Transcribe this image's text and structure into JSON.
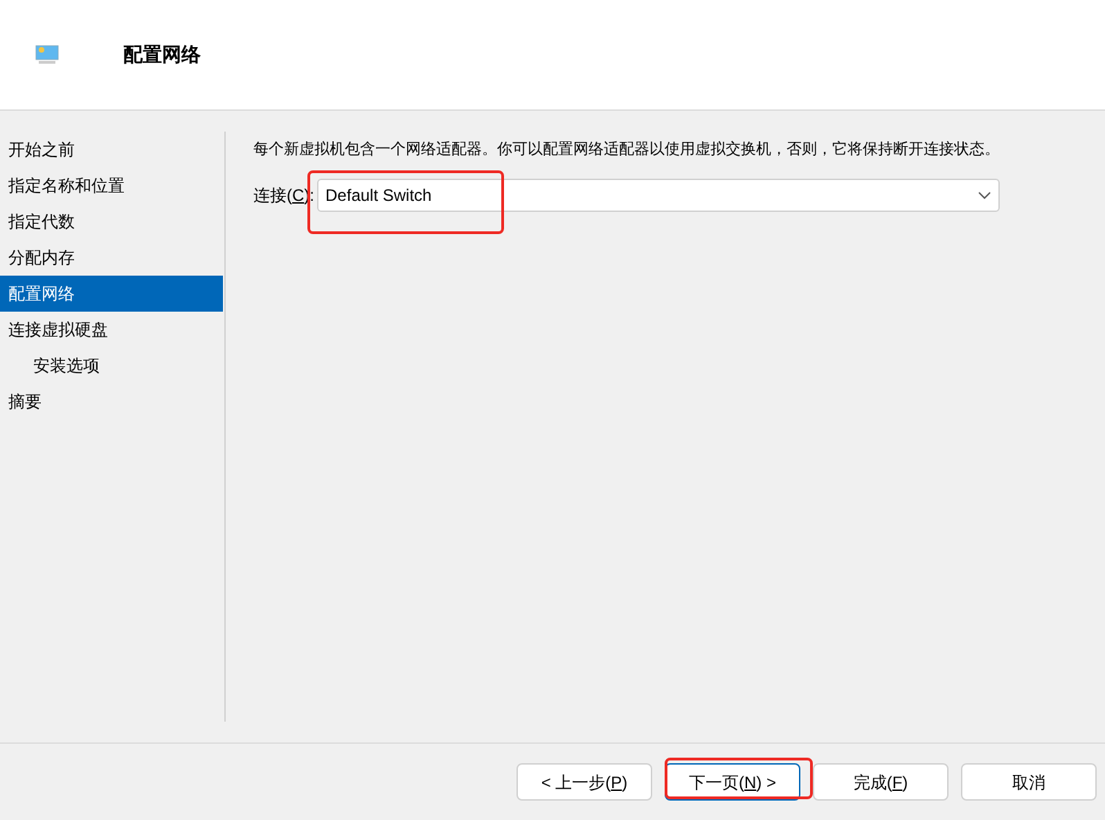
{
  "header": {
    "title": "配置网络"
  },
  "steps": [
    {
      "label": "开始之前",
      "selected": false
    },
    {
      "label": "指定名称和位置",
      "selected": false
    },
    {
      "label": "指定代数",
      "selected": false
    },
    {
      "label": "分配内存",
      "selected": false
    },
    {
      "label": "配置网络",
      "selected": true
    },
    {
      "label": "连接虚拟硬盘",
      "selected": false,
      "children": [
        {
          "label": "安装选项",
          "selected": false
        }
      ]
    },
    {
      "label": "摘要",
      "selected": false
    }
  ],
  "description": "每个新虚拟机包含一个网络适配器。你可以配置网络适配器以使用虚拟交换机，否则，它将保持断开连接状态。",
  "connection": {
    "label": {
      "before": "连接(",
      "key": "C",
      "after": "):"
    },
    "value": "Default Switch",
    "highlighted": true
  },
  "buttons": [
    {
      "before": "< 上一步(",
      "key": "P",
      "after": ")",
      "focused": false,
      "highlighted": false
    },
    {
      "before": "下一页(",
      "key": "N",
      "after": ") >",
      "focused": true,
      "highlighted": true
    },
    {
      "before": "完成(",
      "key": "F",
      "after": ")",
      "focused": false,
      "highlighted": false
    },
    {
      "before": "取消",
      "focused": false,
      "highlighted": false
    }
  ]
}
